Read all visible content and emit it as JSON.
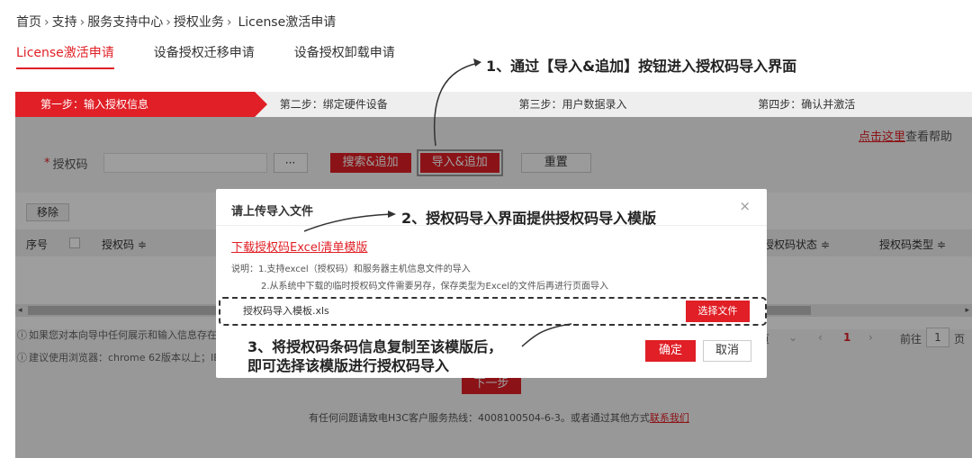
{
  "breadcrumb": [
    "首页",
    "支持",
    "服务支持中心",
    "授权业务",
    "License激活申请"
  ],
  "breadcrumb_sep": "›",
  "tabs": [
    {
      "label": "License激活申请",
      "active": true
    },
    {
      "label": "设备授权迁移申请",
      "active": false
    },
    {
      "label": "设备授权卸载申请",
      "active": false
    }
  ],
  "steps": [
    {
      "label": "第一步：输入授权信息",
      "active": true
    },
    {
      "label": "第二步：绑定硬件设备",
      "active": false
    },
    {
      "label": "第三步：用户数据录入",
      "active": false
    },
    {
      "label": "第四步：确认并激活",
      "active": false
    }
  ],
  "help": {
    "link": "点击这里",
    "text": "查看帮助"
  },
  "form": {
    "required_mark": "*",
    "label": "授权码",
    "value": "",
    "dots_label": "···",
    "search_add_label": "搜索&追加",
    "import_add_label": "导入&追加",
    "reset_label": "重置"
  },
  "table": {
    "remove_label": "移除",
    "columns": [
      "序号",
      "授权码 ≑",
      "授权码状态 ≑",
      "授权码类型 ≑"
    ]
  },
  "notes": [
    "如果您对本向导中任何展示和输入信息存在疑",
    "建议使用浏览器：chrome 62版本以上；IE 1"
  ],
  "pager": {
    "size_select": "页",
    "prev": "‹",
    "current": "1",
    "next": "›",
    "goto_label": "前往",
    "goto_value": "1",
    "page_unit": "页"
  },
  "next_step_label": "下一步",
  "footer": {
    "text": "有任何问题请致电H3C客户服务热线：4008100504-6-3。或者通过其他方式",
    "link": "联系我们"
  },
  "modal": {
    "title": "请上传导入文件",
    "close": "×",
    "template_link": "下载授权码Excel清单模版",
    "desc": [
      "说明：1.支持excel（授权码）和服务器主机信息文件的导入",
      "2.从系统中下载的临时授权码文件需要另存，保存类型为Excel的文件后再进行页面导入"
    ],
    "file_name": "授权码导入模板.xls",
    "choose_label": "选择文件",
    "ok_label": "确定",
    "cancel_label": "取消"
  },
  "annotations": [
    "1、通过【导入&追加】按钮进入授权码导入界面",
    "2、授权码导入界面提供授权码导入模版",
    "3、将授权码条码信息复制至该模版后，",
    "即可选择该模版进行授权码导入"
  ]
}
